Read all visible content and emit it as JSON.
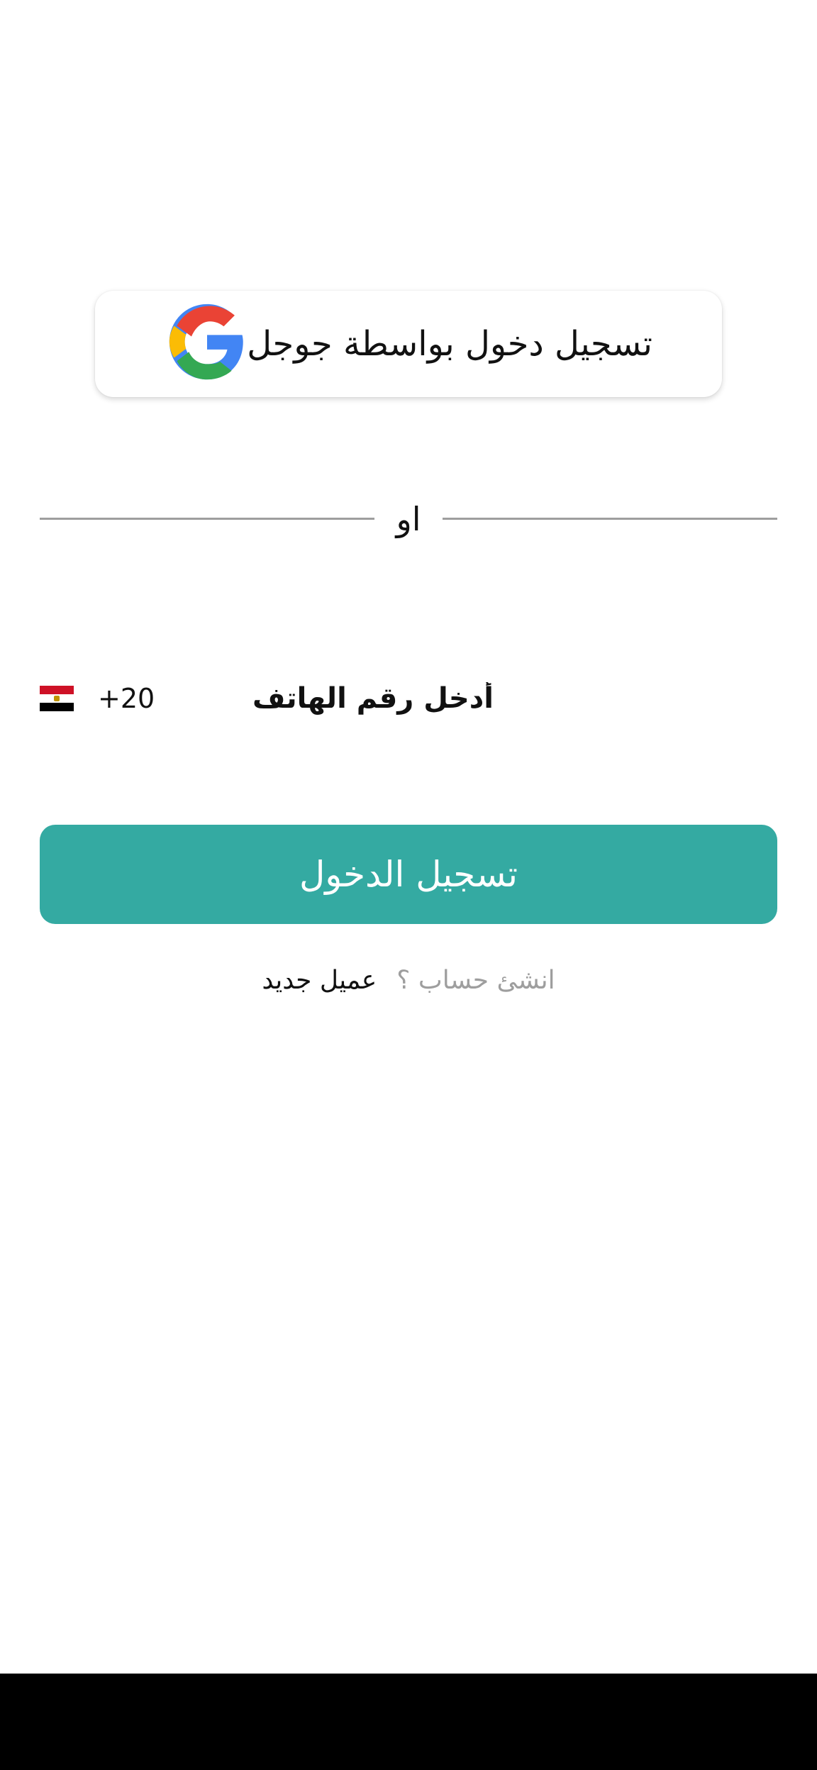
{
  "google_signin": {
    "label": "تسجيل دخول بواسطة جوجل",
    "icon": "google-g-icon",
    "colors": {
      "blue": "#4285F4",
      "red": "#EA4335",
      "yellow": "#FBBC05",
      "green": "#34A853"
    }
  },
  "divider": {
    "label": "او"
  },
  "phone": {
    "flag_icon": "egypt-flag-icon",
    "dial_code": "+20",
    "placeholder": "أدخل رقم الهاتف",
    "value": ""
  },
  "login_button": {
    "label": "تسجيل الدخول",
    "color": "#34aaa2"
  },
  "signup": {
    "prompt": "عميل جديد",
    "link": "انشئ حساب ؟"
  }
}
